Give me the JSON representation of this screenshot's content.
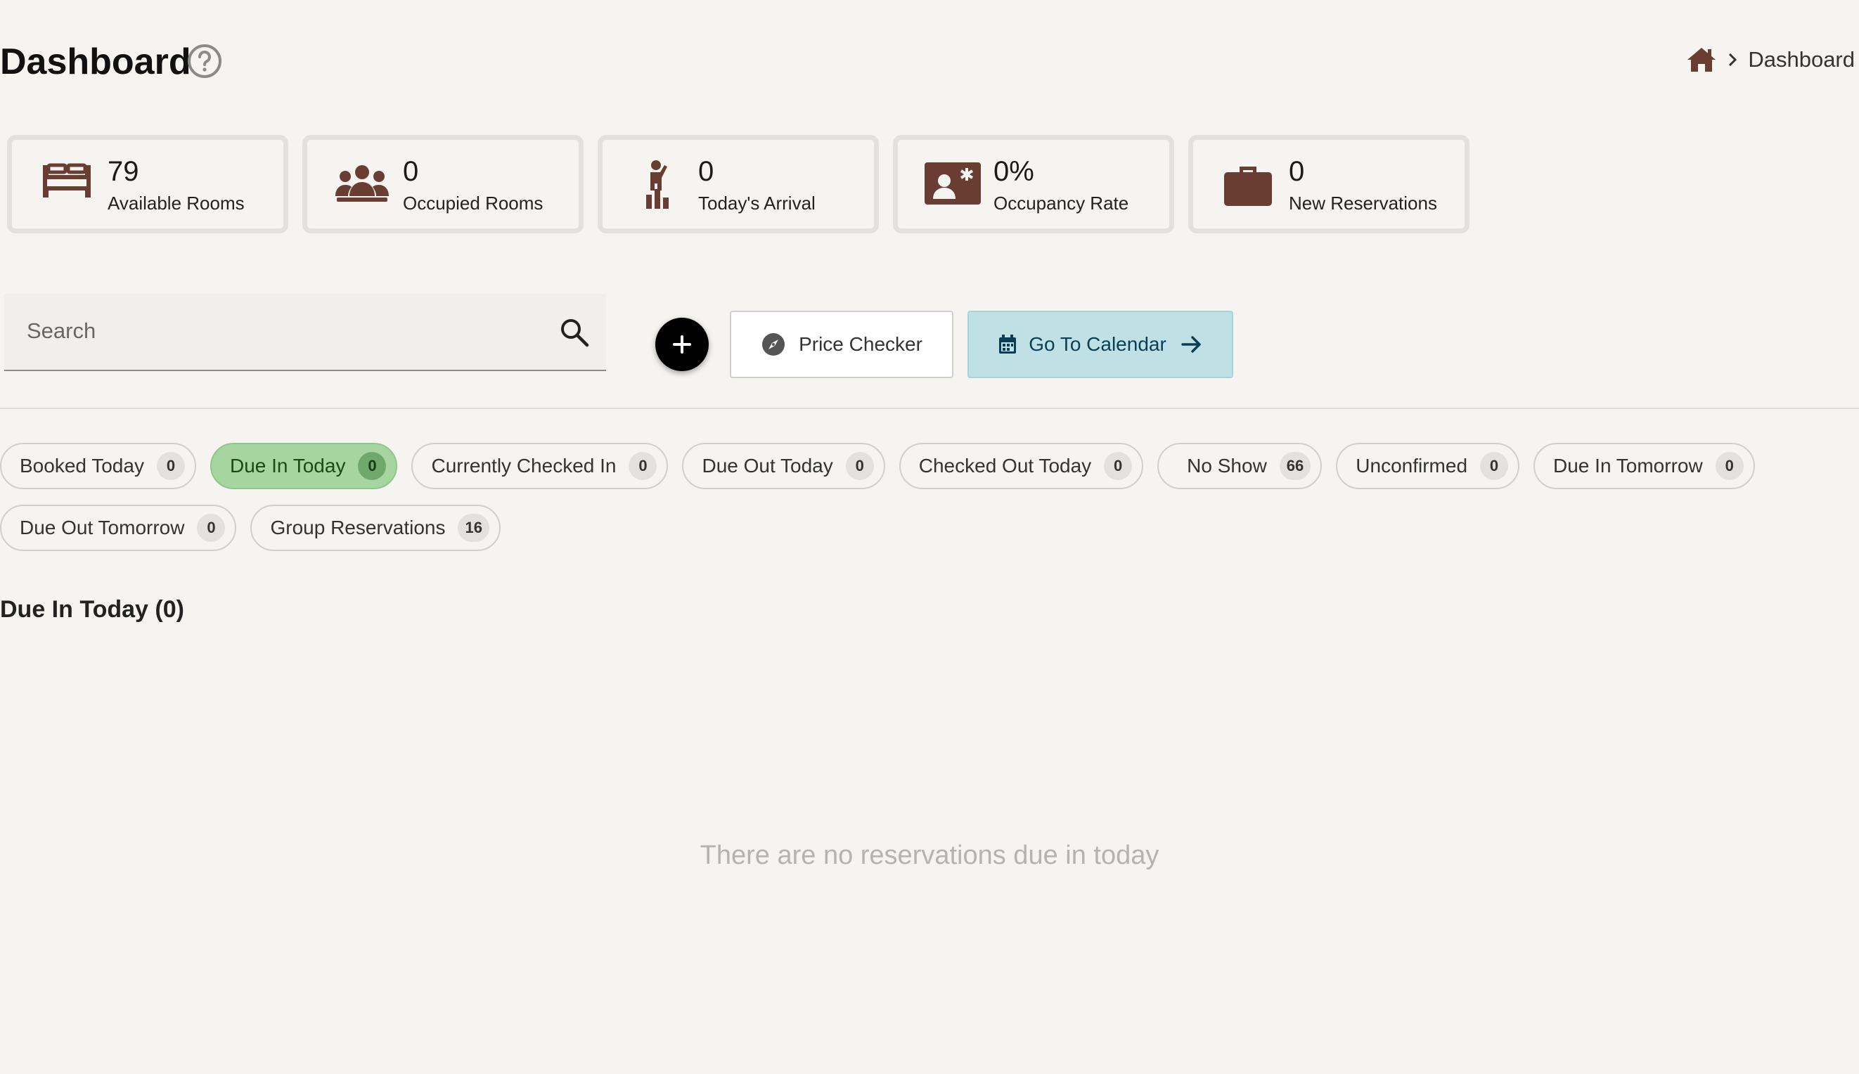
{
  "header": {
    "title": "Dashboard",
    "breadcrumb": [
      "Dashboard"
    ]
  },
  "colors": {
    "icon_brown": "#6a3d33",
    "active_chip": "#a7d5a0",
    "calendar_button": "#bfe1e6"
  },
  "stats": [
    {
      "icon": "bed-icon",
      "value": "79",
      "label": "Available Rooms"
    },
    {
      "icon": "group-icon",
      "value": "0",
      "label": "Occupied Rooms"
    },
    {
      "icon": "arrival-icon",
      "value": "0",
      "label": "Today's Arrival"
    },
    {
      "icon": "id-card-icon",
      "value": "0%",
      "label": "Occupancy Rate"
    },
    {
      "icon": "briefcase-icon",
      "value": "0",
      "label": "New Reservations"
    }
  ],
  "toolbar": {
    "search_placeholder": "Search",
    "price_checker_label": "Price Checker",
    "calendar_label": "Go To Calendar"
  },
  "filters": [
    {
      "label": "Booked Today",
      "count": "0",
      "active": false
    },
    {
      "label": "Due In Today",
      "count": "0",
      "active": true
    },
    {
      "label": "Currently Checked In",
      "count": "0",
      "active": false
    },
    {
      "label": "Due Out Today",
      "count": "0",
      "active": false
    },
    {
      "label": "Checked Out Today",
      "count": "0",
      "active": false
    },
    {
      "label": "No Show",
      "count": "66",
      "active": false
    },
    {
      "label": "Unconfirmed",
      "count": "0",
      "active": false
    },
    {
      "label": "Due In Tomorrow",
      "count": "0",
      "active": false
    },
    {
      "label": "Due Out Tomorrow",
      "count": "0",
      "active": false
    },
    {
      "label": "Group Reservations",
      "count": "16",
      "active": false
    }
  ],
  "section": {
    "title": "Due In Today (0)",
    "empty_message": "There are no reservations due in today"
  }
}
